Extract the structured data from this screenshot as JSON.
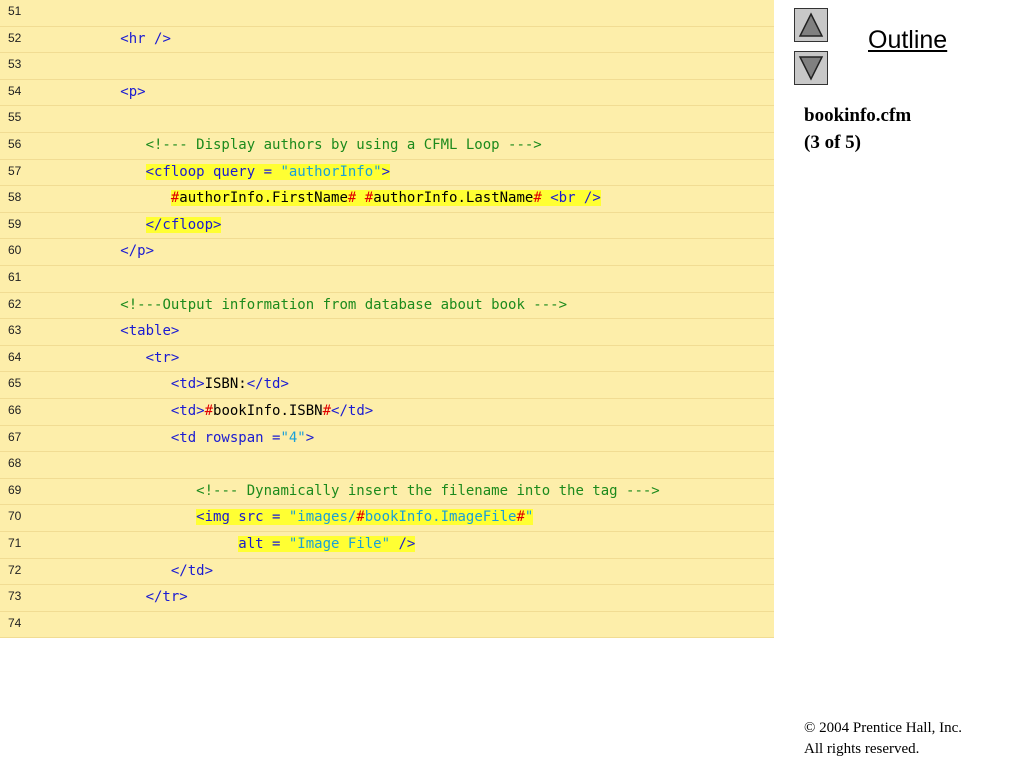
{
  "nav": {
    "up_icon": "triangle-up-icon",
    "down_icon": "triangle-down-icon"
  },
  "sidebar": {
    "outline_label": "Outline",
    "filename": "bookinfo.cfm",
    "page_indicator": "(3 of 5)",
    "copyright_symbol": "©",
    "copyright_line": " 2004 Prentice Hall, Inc.",
    "rights_line": "All rights reserved."
  },
  "colors": {
    "code_background": "#fdeeaa",
    "highlight": "#ffff33",
    "tag": "#1a1ad2",
    "comment": "#1c8a1c",
    "string": "#1aa0d8",
    "pound": "#e00000"
  },
  "code_lines": [
    {
      "num": "51",
      "segments": []
    },
    {
      "num": "52",
      "segments": [
        {
          "t": "          ",
          "c": "txt"
        },
        {
          "t": "<hr />",
          "c": "tag"
        }
      ]
    },
    {
      "num": "53",
      "segments": []
    },
    {
      "num": "54",
      "segments": [
        {
          "t": "          ",
          "c": "txt"
        },
        {
          "t": "<p>",
          "c": "tag"
        }
      ]
    },
    {
      "num": "55",
      "segments": []
    },
    {
      "num": "56",
      "segments": [
        {
          "t": "             ",
          "c": "txt"
        },
        {
          "t": "<!--- Display authors by using a CFML Loop --->",
          "c": "cmt"
        }
      ]
    },
    {
      "num": "57",
      "segments": [
        {
          "t": "             ",
          "c": "txt"
        },
        {
          "t": "<cfloop query = ",
          "c": "tag",
          "hl": true
        },
        {
          "t": "\"authorInfo\"",
          "c": "str",
          "hl": true
        },
        {
          "t": ">",
          "c": "tag",
          "hl": true
        }
      ]
    },
    {
      "num": "58",
      "segments": [
        {
          "t": "                ",
          "c": "txt"
        },
        {
          "t": "#",
          "c": "pound",
          "hl": true
        },
        {
          "t": "authorInfo.FirstName",
          "c": "txt",
          "hl": true
        },
        {
          "t": "#",
          "c": "pound",
          "hl": true
        },
        {
          "t": " ",
          "c": "txt",
          "hl": true
        },
        {
          "t": "#",
          "c": "pound",
          "hl": true
        },
        {
          "t": "authorInfo.LastName",
          "c": "txt",
          "hl": true
        },
        {
          "t": "#",
          "c": "pound",
          "hl": true
        },
        {
          "t": " <br />",
          "c": "tag",
          "hl": true
        }
      ]
    },
    {
      "num": "59",
      "segments": [
        {
          "t": "             ",
          "c": "txt"
        },
        {
          "t": "</cfloop>",
          "c": "tag",
          "hl": true
        }
      ]
    },
    {
      "num": "60",
      "segments": [
        {
          "t": "          ",
          "c": "txt"
        },
        {
          "t": "</p>",
          "c": "tag"
        }
      ]
    },
    {
      "num": "61",
      "segments": []
    },
    {
      "num": "62",
      "segments": [
        {
          "t": "          ",
          "c": "txt"
        },
        {
          "t": "<!---Output information from database about book --->",
          "c": "cmt"
        }
      ]
    },
    {
      "num": "63",
      "segments": [
        {
          "t": "          ",
          "c": "txt"
        },
        {
          "t": "<table>",
          "c": "tag"
        }
      ]
    },
    {
      "num": "64",
      "segments": [
        {
          "t": "             ",
          "c": "txt"
        },
        {
          "t": "<tr>",
          "c": "tag"
        }
      ]
    },
    {
      "num": "65",
      "segments": [
        {
          "t": "                ",
          "c": "txt"
        },
        {
          "t": "<td>",
          "c": "tag"
        },
        {
          "t": "ISBN:",
          "c": "txt"
        },
        {
          "t": "</td>",
          "c": "tag"
        }
      ]
    },
    {
      "num": "66",
      "segments": [
        {
          "t": "                ",
          "c": "txt"
        },
        {
          "t": "<td>",
          "c": "tag"
        },
        {
          "t": "#",
          "c": "pound"
        },
        {
          "t": "bookInfo.ISBN",
          "c": "txt"
        },
        {
          "t": "#",
          "c": "pound"
        },
        {
          "t": "</td>",
          "c": "tag"
        }
      ]
    },
    {
      "num": "67",
      "segments": [
        {
          "t": "                ",
          "c": "txt"
        },
        {
          "t": "<td rowspan =",
          "c": "tag"
        },
        {
          "t": "\"4\"",
          "c": "str"
        },
        {
          "t": ">",
          "c": "tag"
        }
      ]
    },
    {
      "num": "68",
      "segments": []
    },
    {
      "num": "69",
      "segments": [
        {
          "t": "                   ",
          "c": "txt"
        },
        {
          "t": "<!--- Dynamically insert the filename into the tag --->",
          "c": "cmt"
        }
      ]
    },
    {
      "num": "70",
      "segments": [
        {
          "t": "                   ",
          "c": "txt"
        },
        {
          "t": "<img src = ",
          "c": "tag",
          "hl": true
        },
        {
          "t": "\"images/",
          "c": "str",
          "hl": true
        },
        {
          "t": "#",
          "c": "pound",
          "hl": true
        },
        {
          "t": "bookInfo.ImageFile",
          "c": "str",
          "hl": true
        },
        {
          "t": "#",
          "c": "pound",
          "hl": true
        },
        {
          "t": "\"",
          "c": "str",
          "hl": true
        }
      ]
    },
    {
      "num": "71",
      "segments": [
        {
          "t": "                        ",
          "c": "txt"
        },
        {
          "t": "alt = ",
          "c": "tag",
          "hl": true
        },
        {
          "t": "\"Image File\"",
          "c": "str",
          "hl": true
        },
        {
          "t": " />",
          "c": "tag",
          "hl": true
        }
      ]
    },
    {
      "num": "72",
      "segments": [
        {
          "t": "                ",
          "c": "txt"
        },
        {
          "t": "</td>",
          "c": "tag"
        }
      ]
    },
    {
      "num": "73",
      "segments": [
        {
          "t": "             ",
          "c": "txt"
        },
        {
          "t": "</tr>",
          "c": "tag"
        }
      ]
    },
    {
      "num": "74",
      "segments": []
    }
  ]
}
